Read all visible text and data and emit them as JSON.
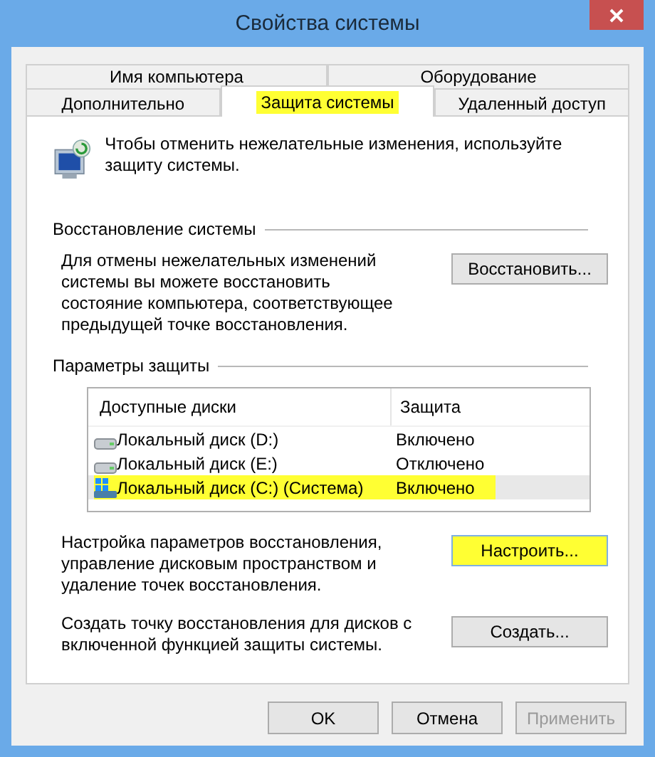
{
  "window": {
    "title": "Свойства системы"
  },
  "tab_rows": [
    [
      {
        "label": "Имя компьютера",
        "selected": false,
        "highlighted": false
      },
      {
        "label": "Оборудование",
        "selected": false,
        "highlighted": false
      }
    ],
    [
      {
        "label": "Дополнительно",
        "selected": false,
        "highlighted": false
      },
      {
        "label": "Защита системы",
        "selected": true,
        "highlighted": true
      },
      {
        "label": "Удаленный доступ",
        "selected": false,
        "highlighted": false
      }
    ]
  ],
  "intro": "Чтобы отменить нежелательные изменения, используйте защиту системы.",
  "restore": {
    "title": "Восстановление системы",
    "text": "Для отмены нежелательных изменений системы вы можете восстановить состояние компьютера, соответствующее предыдущей точке восстановления.",
    "button": {
      "label": "Восстановить...",
      "highlighted": false
    }
  },
  "protection": {
    "title": "Параметры защиты",
    "columns": [
      "Доступные диски",
      "Защита"
    ],
    "rows": [
      {
        "kind": "drive",
        "name": "Локальный диск (D:)",
        "protection": "Включено",
        "selected": false,
        "highlighted": false
      },
      {
        "kind": "drive",
        "name": "Локальный диск (E:)",
        "protection": "Отключено",
        "selected": false,
        "highlighted": false
      },
      {
        "kind": "system",
        "name": "Локальный диск (C:) (Система)",
        "protection": "Включено",
        "selected": true,
        "highlighted": true
      }
    ],
    "configure": {
      "text": "Настройка параметров восстановления, управление дисковым пространством и удаление точек восстановления.",
      "button": {
        "label": "Настроить...",
        "highlighted": true
      }
    },
    "create": {
      "text": "Создать точку восстановления для дисков с включенной функцией защиты системы.",
      "button": {
        "label": "Создать...",
        "highlighted": false
      }
    }
  },
  "buttons": [
    {
      "label": "OK",
      "disabled": false
    },
    {
      "label": "Отмена",
      "disabled": false
    },
    {
      "label": "Применить",
      "disabled": true
    }
  ]
}
